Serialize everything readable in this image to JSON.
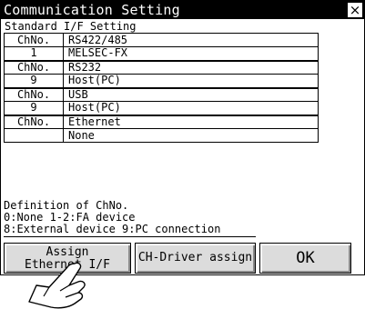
{
  "window": {
    "title": "Communication Setting",
    "close_glyph": "×"
  },
  "standard": {
    "label": "Standard I/F Setting",
    "rows": [
      {
        "ch_label": "ChNo.",
        "type": "RS422/485",
        "ch_value": "1",
        "driver": "MELSEC-FX"
      },
      {
        "ch_label": "ChNo.",
        "type": "RS232",
        "ch_value": "9",
        "driver": "Host(PC)"
      },
      {
        "ch_label": "ChNo.",
        "type": "USB",
        "ch_value": "9",
        "driver": "Host(PC)"
      },
      {
        "ch_label": "ChNo.",
        "type": "Ethernet",
        "ch_value": "",
        "driver": "None"
      }
    ]
  },
  "definition": {
    "line1": "Definition of ChNo.",
    "line2": "0:None 1-2:FA device",
    "line3": "8:External device 9:PC connection"
  },
  "buttons": {
    "assign_line1": "Assign",
    "assign_line2": "Ethernet I/F",
    "ch_driver": "CH-Driver assign",
    "ok": "OK"
  },
  "icons": {
    "pointer": "pointing-hand-icon"
  }
}
